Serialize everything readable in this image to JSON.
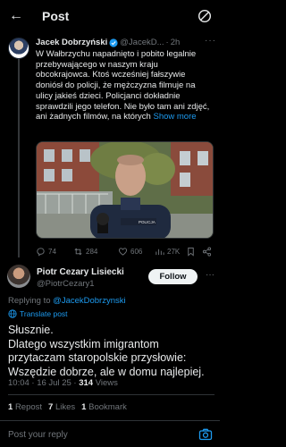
{
  "header": {
    "title": "Post",
    "back_icon": "arrow-left-icon",
    "right_icon": "no-notifications-icon"
  },
  "parent": {
    "name": "Jacek Dobrzyński",
    "handle": "@JacekD...",
    "separator": "·",
    "time": "2h",
    "more": "···",
    "text": "W Wałbrzychu napadnięto i pobito legalnie przebywającego w naszym kraju obcokrajowca. Ktoś wcześniej fałszywie doniósł do policji, że mężczyzna filmuje na ulicy jakieś dzieci. Policjanci dokładnie sprawdzili jego telefon. Nie było tam ani zdjęć, ani żadnych filmów, na których",
    "show_more": "Show more",
    "media_text": "POLICJA",
    "actions": {
      "replies": "74",
      "reposts": "284",
      "likes": "606",
      "views": "27K"
    }
  },
  "reply": {
    "name": "Piotr Cezary Lisiecki",
    "handle": "@PiotrCezary1",
    "follow_label": "Follow",
    "more": "···",
    "replying_prefix": "Replying to",
    "replying_to": "@JacekDobrzynski",
    "translate": "Translate post",
    "lines": [
      "Słusznie.",
      "Dlatego wszystkim imigrantom przytaczam staropolskie przysłowie:",
      "Wszędzie dobrze, ale w domu najlepiej."
    ],
    "timestamp": "10:04 · 16 Jul 25 ·",
    "views_count": "314",
    "views_label": "Views",
    "stats": {
      "reposts_count": "1",
      "reposts_label": "Repost",
      "likes_count": "7",
      "likes_label": "Likes",
      "bookmarks_count": "1",
      "bookmarks_label": "Bookmark"
    }
  },
  "composer": {
    "placeholder": "Post your reply"
  },
  "colors": {
    "accent": "#1d9bf0",
    "background": "#000000",
    "muted": "#71767b",
    "text": "#e7e9ea"
  }
}
